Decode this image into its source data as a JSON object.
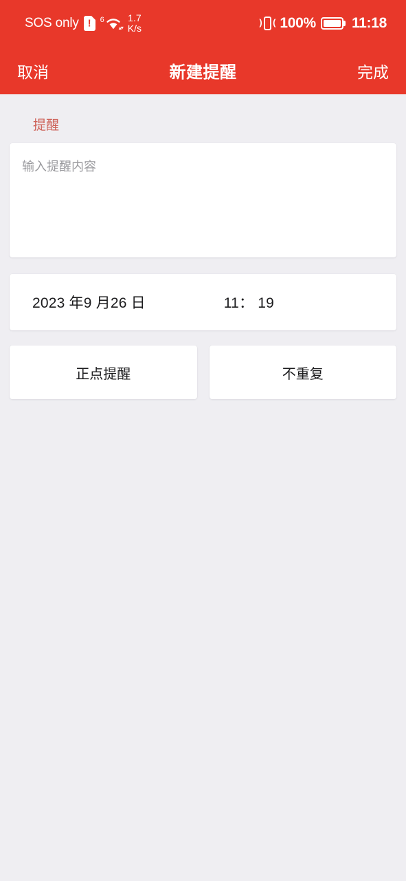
{
  "theme": {
    "accent_red": "#E8382A",
    "page_background": "#EFEEF2",
    "card_background": "#FFFFFF",
    "section_label_color": "#CE6259",
    "placeholder_color": "#9A9A9E"
  },
  "status_bar": {
    "carrier_text": "SOS only",
    "sim_icon": "sim-card-warning-icon",
    "wifi_generation": "6",
    "wifi_icon": "wifi-icon",
    "wifi_transfer_icon": "wifi-updown-arrows-icon",
    "network_speed_value": "1.7",
    "network_speed_unit": "K/s",
    "vibrate_icon": "vibrate-mode-icon",
    "battery_percent": "100%",
    "battery_icon": "battery-full-icon",
    "clock": "11:18"
  },
  "nav_bar": {
    "cancel_label": "取消",
    "title": "新建提醒",
    "done_label": "完成"
  },
  "content": {
    "section_label": "提醒",
    "note": {
      "placeholder": "输入提醒内容",
      "value": ""
    },
    "datetime": {
      "date": "2023 年9 月26 日",
      "time": "11： 19"
    },
    "options": [
      {
        "label": "正点提醒"
      },
      {
        "label": "不重复"
      }
    ]
  }
}
